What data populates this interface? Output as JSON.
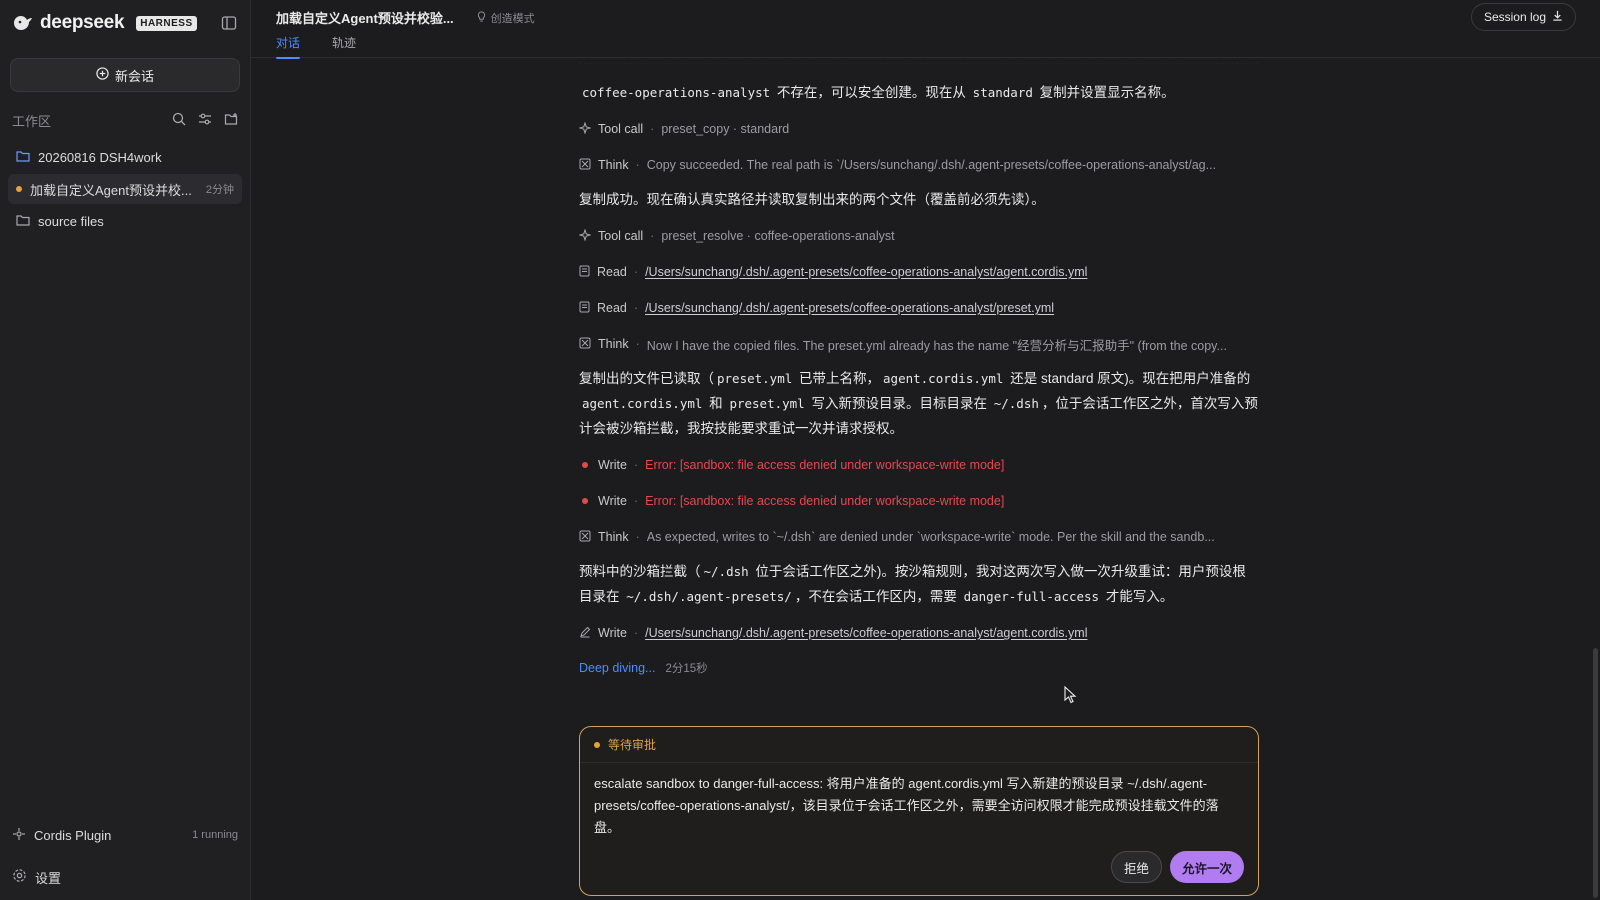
{
  "sidebar": {
    "brand_name": "deepseek",
    "brand_badge": "HARNESS",
    "new_chat_label": "新会话",
    "workspace_label": "工作区",
    "items": [
      {
        "label": "20260816 DSH4work",
        "icon": "folder-icon"
      },
      {
        "label": "加载自定义Agent预设并校...",
        "meta": "2分钟",
        "icon": "status-dot"
      },
      {
        "label": "source files",
        "icon": "folder-icon"
      }
    ],
    "plugin": {
      "label": "Cordis Plugin",
      "meta": "1 running"
    },
    "settings_label": "设置"
  },
  "header": {
    "title": "加载自定义Agent预设并校验...",
    "mode": "创造模式",
    "tabs": [
      {
        "label": "对话",
        "active": true
      },
      {
        "label": "轨迹",
        "active": false
      }
    ],
    "session_log": "Session log"
  },
  "transcript": {
    "p1": {
      "a": "coffee-operations-analyst",
      "b": " 不存在，可以安全创建。现在从 ",
      "c": "standard",
      "d": " 复制并设置显示名称。"
    },
    "s1": {
      "label": "Tool call",
      "detail": "preset_copy · standard"
    },
    "s2": {
      "label": "Think",
      "detail": "Copy succeeded. The real path is `/Users/sunchang/.dsh/.agent-presets/coffee-operations-analyst/ag..."
    },
    "p2": "复制成功。现在确认真实路径并读取复制出来的两个文件（覆盖前必须先读）。",
    "s3": {
      "label": "Tool call",
      "detail": "preset_resolve · coffee-operations-analyst"
    },
    "s4": {
      "label": "Read",
      "detail": "/Users/sunchang/.dsh/.agent-presets/coffee-operations-analyst/agent.cordis.yml"
    },
    "s5": {
      "label": "Read",
      "detail": "/Users/sunchang/.dsh/.agent-presets/coffee-operations-analyst/preset.yml"
    },
    "s6": {
      "label": "Think",
      "detail": "Now I have the copied files. The preset.yml already has the name \"经营分析与汇报助手\" (from the copy..."
    },
    "p3": {
      "t1": "复制出的文件已读取（",
      "c1": "preset.yml",
      "t2": " 已带上名称，",
      "c2": "agent.cordis.yml",
      "t3": " 还是 standard 原文)。现在把用户准备的 ",
      "c3": "agent.cordis.yml",
      "t4": " 和 ",
      "c4": "preset.yml",
      "t5": " 写入新预设目录。目标目录在 ",
      "c5": "~/.dsh",
      "t6": "，位于会话工作区之外，首次写入预计会被沙箱拦截，我按技能要求重试一次并请求授权。"
    },
    "s7": {
      "label": "Write",
      "detail": "Error: [sandbox: file access denied under workspace-write mode]"
    },
    "s8": {
      "label": "Write",
      "detail": "Error: [sandbox: file access denied under workspace-write mode]"
    },
    "s9": {
      "label": "Think",
      "detail": "As expected, writes to `~/.dsh` are denied under `workspace-write` mode. Per the skill and the sandb..."
    },
    "p4": {
      "t1": "预料中的沙箱拦截（",
      "c1": "~/.dsh",
      "t2": " 位于会话工作区之外)。按沙箱规则，我对这两次写入做一次升级重试：用户预设根目录在 ",
      "c2": "~/.dsh/.agent-presets/",
      "t3": "，不在会话工作区内，需要 ",
      "c3": "danger-full-access",
      "t4": " 才能写入。"
    },
    "s10": {
      "label": "Write",
      "detail": "/Users/sunchang/.dsh/.agent-presets/coffee-operations-analyst/agent.cordis.yml"
    },
    "status": {
      "label": "Deep diving...",
      "time": "2分15秒"
    }
  },
  "approval": {
    "title": "等待审批",
    "message": "escalate sandbox to danger-full-access: 将用户准备的 agent.cordis.yml 写入新建的预设目录 ~/.dsh/.agent-presets/coffee-operations-analyst/，该目录位于会话工作区之外，需要全访问权限才能完成预设挂载文件的落盘。",
    "reject_label": "拒绝",
    "allow_label": "允许一次"
  },
  "colors": {
    "accent": "#4c8dff",
    "error": "#e5484d",
    "warning": "#d9a24a",
    "allow": "#b07cf0"
  }
}
